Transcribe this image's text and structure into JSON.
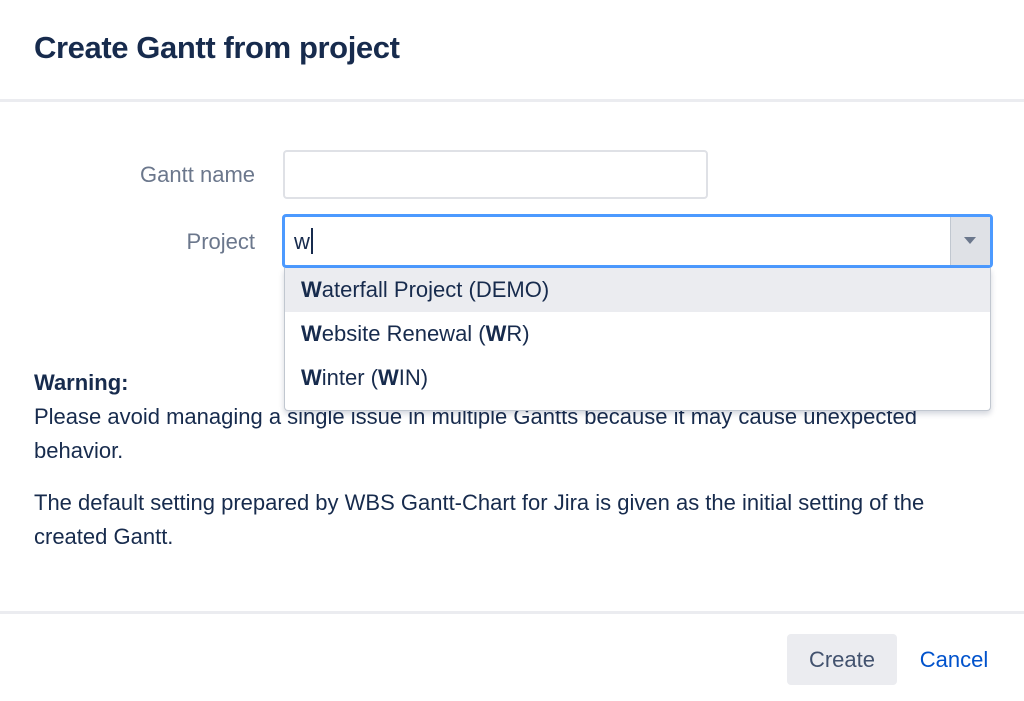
{
  "dialog": {
    "title": "Create Gantt from project"
  },
  "form": {
    "gantt_name_label": "Gantt name",
    "gantt_name_value": "",
    "project_label": "Project",
    "project_query": "w"
  },
  "dropdown": {
    "options": [
      {
        "match": "W",
        "rest": "aterfall Project (DEMO)",
        "highlighted": true
      },
      {
        "match": "W",
        "rest_a": "ebsite Renewal (",
        "match2": "W",
        "rest_b": "R)",
        "highlighted": false
      },
      {
        "match": "W",
        "rest_a": "inter (",
        "match2": "W",
        "rest_b": "IN)",
        "highlighted": false
      }
    ]
  },
  "notice": {
    "warning_title": "Warning:",
    "warning_text": "Please avoid managing a single issue in multiple Gantts because it may cause unexpected behavior.",
    "info_text": "The default setting prepared by WBS Gantt-Chart for Jira is given as the initial setting of the created Gantt."
  },
  "footer": {
    "create_label": "Create",
    "cancel_label": "Cancel"
  },
  "colors": {
    "focus_border": "#4c9aff",
    "link": "#0052cc",
    "heading": "#172b4d",
    "label": "#6b778c"
  },
  "icons": {
    "select_arrow": "chevron-down-icon"
  }
}
